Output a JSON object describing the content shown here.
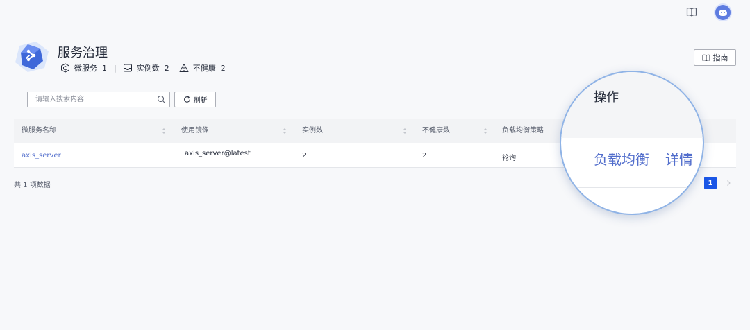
{
  "header": {
    "title": "服务治理",
    "stats": {
      "microservice_label": "微服务",
      "microservice_count": "1",
      "separator": "|",
      "instance_label": "实例数",
      "instance_count": "2",
      "unhealthy_label": "不健康",
      "unhealthy_count": "2"
    },
    "guide_label": "指南"
  },
  "toolbar": {
    "search_placeholder": "请输入搜索内容",
    "search_value": "",
    "refresh_label": "刷新"
  },
  "table": {
    "columns": [
      "微服务名称",
      "使用镜像",
      "实例数",
      "不健康数",
      "负载均衡策略"
    ],
    "rows": [
      {
        "name": "axis_server",
        "image": "axis_server@latest",
        "instances": "2",
        "unhealthy": "2",
        "strategy": "轮询"
      }
    ]
  },
  "pagination": {
    "total": "共 1 项数据",
    "current_page": "1"
  },
  "magnifier": {
    "column_header": "操作",
    "actions": [
      "负载均衡",
      "详情"
    ]
  },
  "colors": {
    "accent": "#526ecc",
    "page_active": "#1a56e6",
    "magnifier_border": "#8fb3e6"
  },
  "icons": {
    "top_book": "book-icon",
    "avatar": "robot-avatar-icon",
    "logo": "service-hexagon-logo-icon",
    "microservice": "cube-network-icon",
    "instance": "inbox-icon",
    "unhealthy": "warning-triangle-icon",
    "search": "search-icon",
    "refresh": "refresh-icon",
    "next": "chevron-right-icon"
  }
}
